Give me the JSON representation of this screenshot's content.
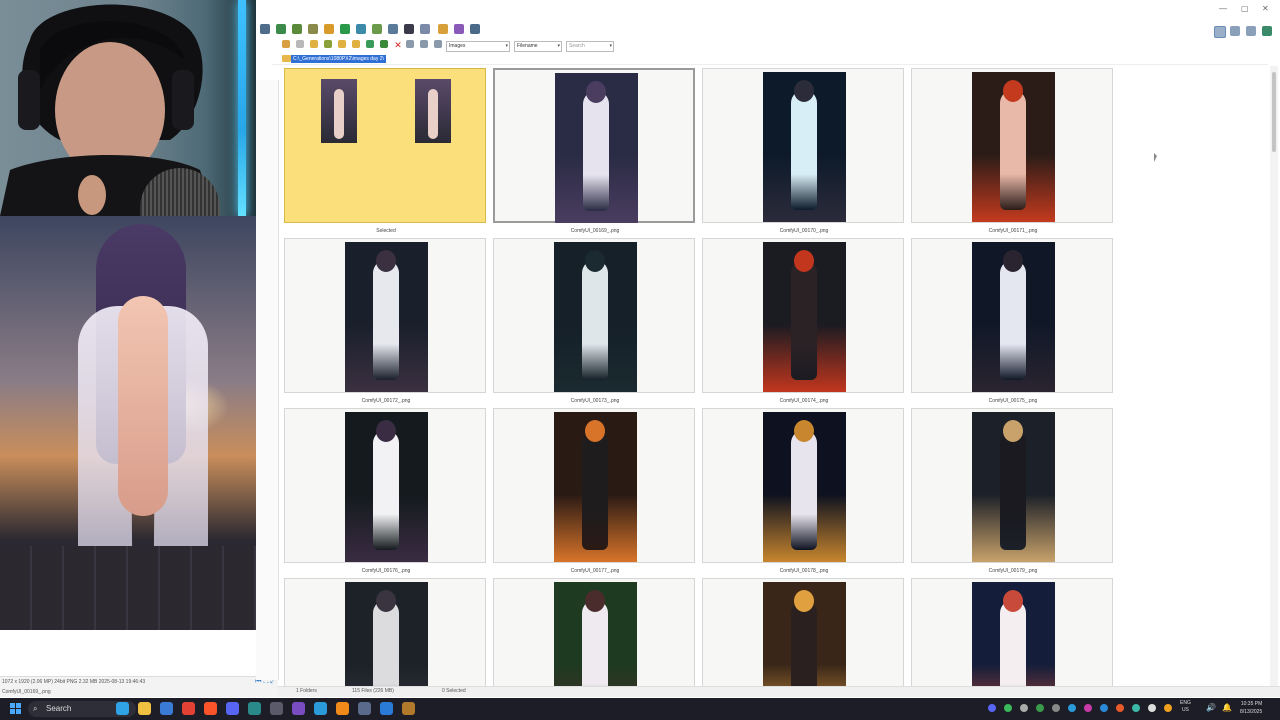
{
  "window": {
    "controls": [
      "—",
      "▢",
      "✕"
    ]
  },
  "toolbar": {
    "folder_filter": "Images",
    "sort_field": "Filename",
    "search_placeholder": "Search",
    "path": "C:\\_Generations\\1080PX2\\images day 2\\"
  },
  "preview": {
    "info": "1072 x 1920 (2.06 MP)  24bit  PNG   2.32 MB   2025-08-13 19:46:43",
    "filename": "ComfyUI_00169_.png",
    "buttons": [
      "⏮",
      "⛶",
      "⤢"
    ]
  },
  "thumbnails": [
    {
      "caption": "Selected",
      "kind": "selected",
      "palette": [
        "#fbdf7a",
        "#5a4a6a",
        "#e8d0c8"
      ]
    },
    {
      "caption": "ComfyUI_00169_.png",
      "kind": "focused",
      "palette": [
        "#2a2b44",
        "#e6e2ee",
        "#4a3d60"
      ]
    },
    {
      "caption": "ComfyUI_00170_.png",
      "kind": "normal",
      "palette": [
        "#0d1a2a",
        "#d8eef6",
        "#2b2b3a"
      ]
    },
    {
      "caption": "ComfyUI_00171_.png",
      "kind": "normal",
      "palette": [
        "#2b1c18",
        "#e8b8a8",
        "#c43a1e"
      ]
    },
    {
      "caption": "ComfyUI_00172_.png",
      "kind": "normal",
      "palette": [
        "#1a1f2c",
        "#e6e8ee",
        "#3a3040"
      ]
    },
    {
      "caption": "ComfyUI_00173_.png",
      "kind": "normal",
      "palette": [
        "#152028",
        "#dfe6ea",
        "#1b2a30"
      ]
    },
    {
      "caption": "ComfyUI_00174_.png",
      "kind": "normal",
      "palette": [
        "#1b1b22",
        "#2b2226",
        "#c2361e"
      ]
    },
    {
      "caption": "ComfyUI_00175_.png",
      "kind": "normal",
      "palette": [
        "#101828",
        "#e4e6f0",
        "#2a2430"
      ]
    },
    {
      "caption": "ComfyUI_00176_.png",
      "kind": "normal",
      "palette": [
        "#141a1e",
        "#f2f2f4",
        "#3a2c42"
      ]
    },
    {
      "caption": "ComfyUI_00177_.png",
      "kind": "normal",
      "palette": [
        "#2a1a14",
        "#1f1c1e",
        "#d8742a"
      ]
    },
    {
      "caption": "ComfyUI_00178_.png",
      "kind": "normal",
      "palette": [
        "#0e1220",
        "#e8e4ee",
        "#c8862e"
      ]
    },
    {
      "caption": "ComfyUI_00179_.png",
      "kind": "normal",
      "palette": [
        "#1c2028",
        "#1a1a20",
        "#c8a26a"
      ]
    },
    {
      "caption": "",
      "kind": "normal",
      "palette": [
        "#1c2228",
        "#dcdcde",
        "#3a3440"
      ]
    },
    {
      "caption": "",
      "kind": "normal",
      "palette": [
        "#1e3a20",
        "#eeeaf0",
        "#4a2c2c"
      ]
    },
    {
      "caption": "",
      "kind": "normal",
      "palette": [
        "#3a2618",
        "#2a2020",
        "#e0a040"
      ]
    },
    {
      "caption": "",
      "kind": "normal",
      "palette": [
        "#141e3a",
        "#f4eef0",
        "#c84a3a"
      ]
    }
  ],
  "statusbar": {
    "folders": "1 Folders",
    "files": "115 Files (226 MB)",
    "selected": "0 Selected"
  },
  "taskbar": {
    "search_label": "Search",
    "lang_top": "ENG",
    "lang_bottom": "US",
    "time": "10:35 PM",
    "date": "8/13/2025",
    "apps": [
      {
        "name": "edge",
        "color": "#2fa3e6"
      },
      {
        "name": "file-explorer",
        "color": "#f0c040"
      },
      {
        "name": "store",
        "color": "#3a7bd5"
      },
      {
        "name": "chrome",
        "color": "#e34133"
      },
      {
        "name": "brave",
        "color": "#fb542b"
      },
      {
        "name": "discord",
        "color": "#5865f2"
      },
      {
        "name": "terminal",
        "color": "#2a8a8a"
      },
      {
        "name": "obs",
        "color": "#5a5a6a"
      },
      {
        "name": "visual-studio",
        "color": "#7a4cc2"
      },
      {
        "name": "notepad",
        "color": "#2a9ad8"
      },
      {
        "name": "vlc",
        "color": "#f08a18"
      },
      {
        "name": "viewer",
        "color": "#5a6a8a"
      },
      {
        "name": "paint",
        "color": "#2a7ad8"
      },
      {
        "name": "settings",
        "color": "#b07a2a"
      }
    ]
  }
}
